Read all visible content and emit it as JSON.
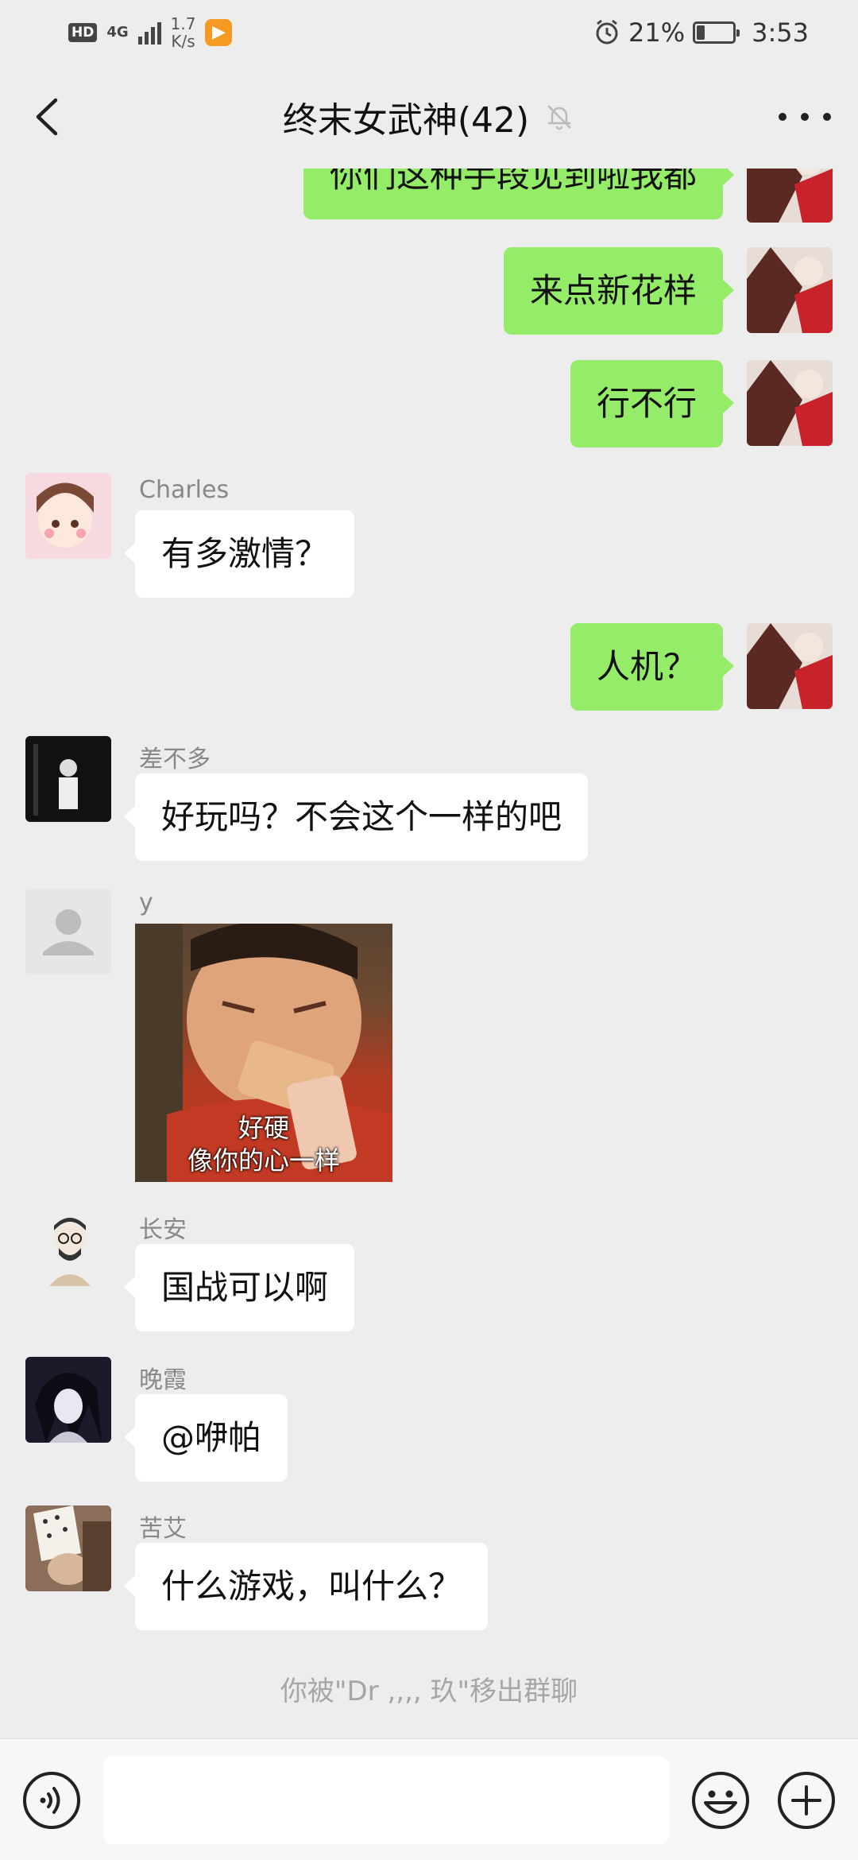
{
  "status_bar": {
    "hd": "HD",
    "network_type": "4G",
    "speed_value": "1.7",
    "speed_unit": "K/s",
    "battery_percent": "21%",
    "battery_level": 0.21,
    "time": "3:53"
  },
  "header": {
    "title": "终末女武神(42)",
    "icons": [
      "back-arrow-icon",
      "mute-bell-icon",
      "more-icon"
    ]
  },
  "messages": [
    {
      "from": "me",
      "text": "你们这种手段见到啦我都"
    },
    {
      "from": "me",
      "text": "来点新花样"
    },
    {
      "from": "me",
      "text": "行不行"
    },
    {
      "from": "other",
      "name": "Charles",
      "text": "有多激情？"
    },
    {
      "from": "me",
      "text": "人机？"
    },
    {
      "from": "other",
      "name": "差不多",
      "text": "好玩吗？不会这个一样的吧"
    },
    {
      "from": "other",
      "name": "y",
      "sticker_caption_1": "好硬",
      "sticker_caption_2": "像你的心一样"
    },
    {
      "from": "other",
      "name": "长安",
      "text": "国战可以啊"
    },
    {
      "from": "other",
      "name": "晚霞",
      "text": "@咿帕"
    },
    {
      "from": "other",
      "name": "苦艾",
      "text": "什么游戏，叫什么？"
    }
  ],
  "system_message": "你被\"Dr ,,,, 玖\"移出群聊",
  "input_bar": {
    "icons": [
      "voice-icon",
      "emoji-icon",
      "plus-icon"
    ]
  },
  "colors": {
    "background": "#ededed",
    "my_bubble": "#95ec69",
    "other_bubble": "#ffffff",
    "system_text": "#a6a6a6"
  }
}
